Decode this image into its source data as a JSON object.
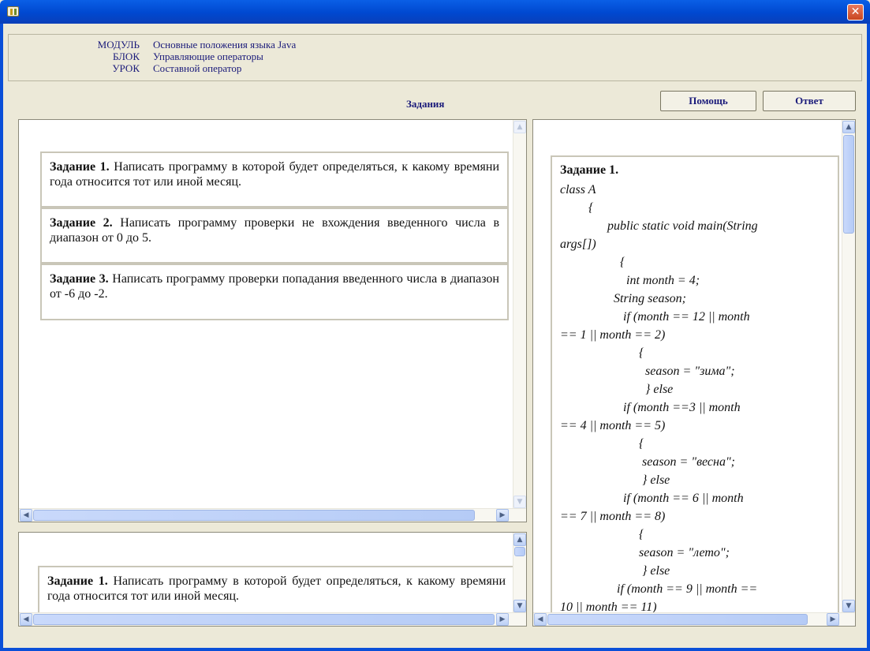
{
  "window": {
    "close_glyph": "✕"
  },
  "info": {
    "module_label": "МОДУЛЬ",
    "module_value": "Основные положения языка Java",
    "block_label": "БЛОК",
    "block_value": "Управляющие операторы",
    "lesson_label": "УРОК",
    "lesson_value": "Составной оператор"
  },
  "toolbar": {
    "section_title": "Задания",
    "help_label": "Помощь",
    "answer_label": "Ответ"
  },
  "tasks": [
    {
      "label": "Задание 1.",
      "text": " Написать программу в которой будет определяться, к какому времяни года относится тот или иной месяц."
    },
    {
      "label": "Задание 2.",
      "text": "  Написать программу проверки не вхождения введенного числа в диапазон от 0 до 5."
    },
    {
      "label": "Задание 3.",
      "text": "  Написать программу проверки попадания введенного числа в диапазон от -6 до -2."
    }
  ],
  "preview": {
    "label": "Задание 1.",
    "text": " Написать программу в которой будет определяться, к какому времяни года относится тот или иной месяц."
  },
  "answer": {
    "title": "Задание 1.",
    "code": "class A\n         {\n               public static void main(String\nargs[])\n                   {\n                     int month = 4;\n                 String season;\n                    if (month == 12 || month\n== 1 || month == 2)\n                         {\n                           season = \"зима\";\n                           } else\n                    if (month ==3 || month\n== 4 || month == 5)\n                         {\n                          season = \"весна\";\n                          } else\n                    if (month == 6 || month\n== 7 || month == 8)\n                         {\n                         season = \"лето\";\n                          } else\n                  if (month == 9 || month ==\n10 || month == 11)"
  },
  "scroll_glyphs": {
    "up": "▲",
    "down": "▼",
    "left": "◀",
    "right": "▶"
  }
}
